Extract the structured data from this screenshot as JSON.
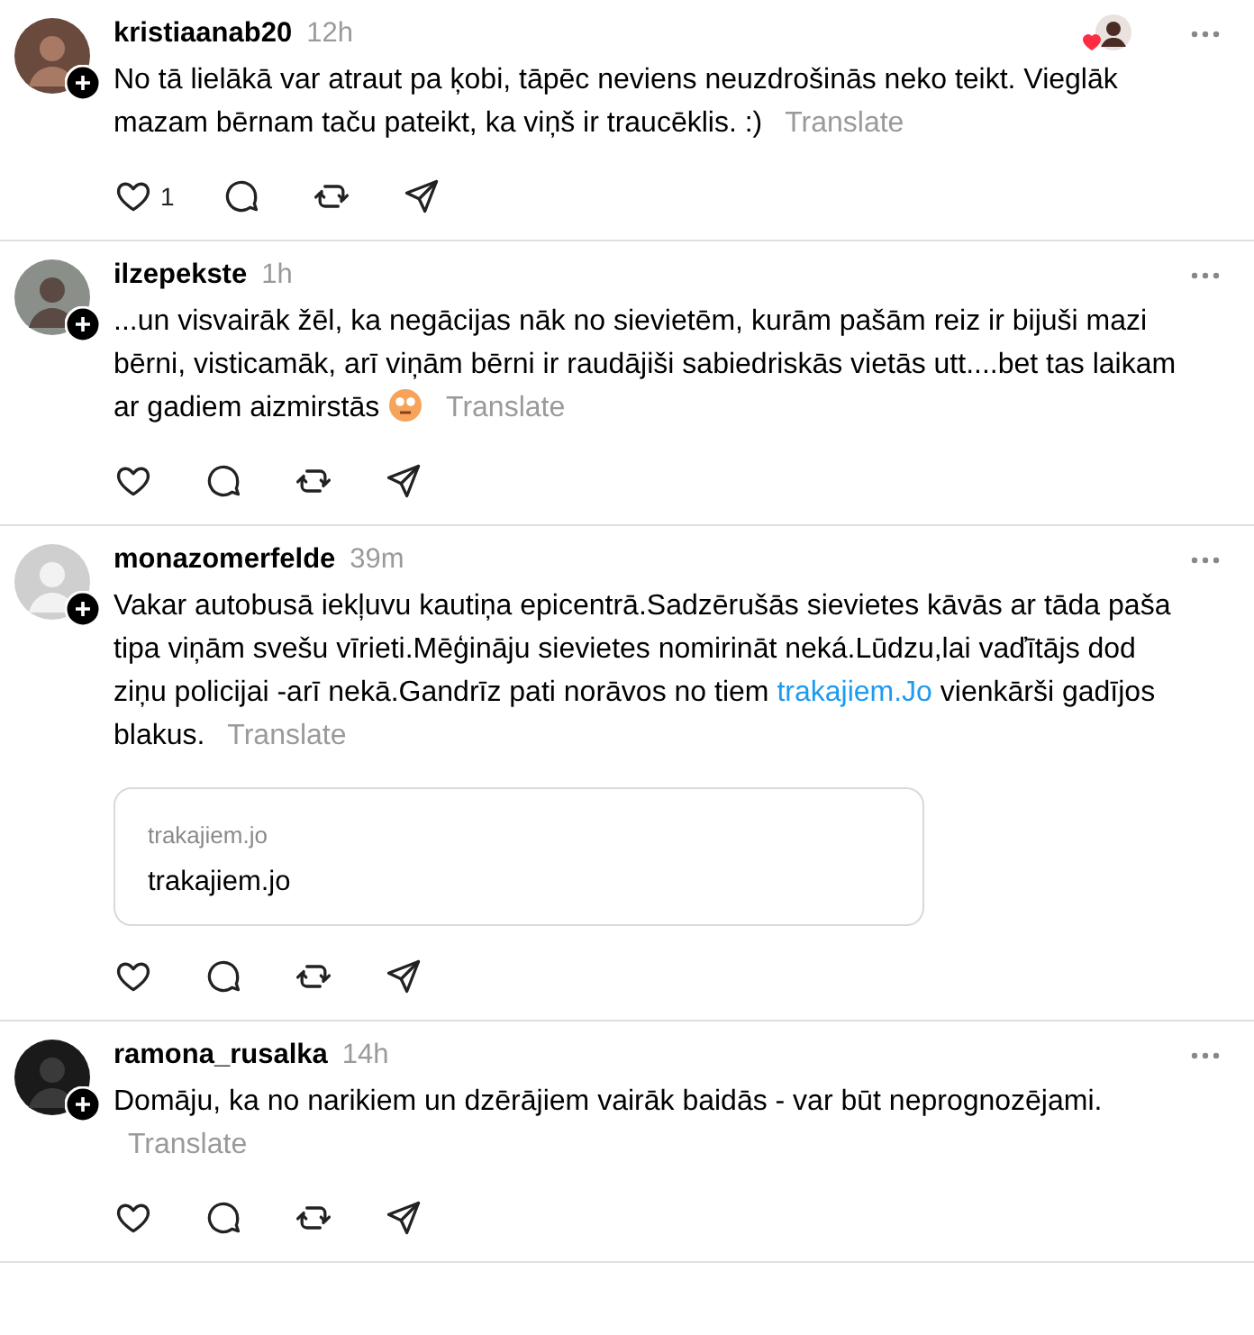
{
  "posts": [
    {
      "username": "kristiaanab20",
      "time": "12h",
      "liked_by": true,
      "parts": [
        {
          "kind": "text",
          "text": "No tā lielākā var atraut pa ķobi, tāpēc neviens neuzdrošinās neko teikt. Vieglāk mazam bērnam taču pateikt, ka viņš ir traucēklis. :)"
        }
      ],
      "translate": "Translate",
      "like_count": "1"
    },
    {
      "username": "ilzepekste",
      "time": "1h",
      "parts": [
        {
          "kind": "text",
          "text": "...un visvairāk žēl, ka negācijas nāk no sievietēm, kurām pašām reiz ir bijuši mazi bērni, visticamāk, arī viņām bērni ir raudājiši sabiedriskās vietās utt....bet tas laikam ar gadiem aizmirstās"
        },
        {
          "kind": "emoji"
        }
      ],
      "translate": "Translate"
    },
    {
      "username": "monazomerfelde",
      "time": "39m",
      "parts": [
        {
          "kind": "text",
          "text": "Vakar autobusā iekļuvu kautiņa epicentrā.Sadzērušās sievietes kāvās ar tāda paša tipa viņām svešu vīrieti.Mēģināju sievietes nomirināt neká.Lūdzu,lai vaďītājs dod ziņu policijai -arī nekā.Gandrīz pati norāvos no tiem"
        },
        {
          "kind": "link",
          "text": "trakajiem.Jo"
        },
        {
          "kind": "text",
          "text": "vienkārši gadījos blakus."
        }
      ],
      "translate": "Translate",
      "link_card": {
        "domain": "trakajiem.jo",
        "title": "trakajiem.jo"
      }
    },
    {
      "username": "ramona_rusalka",
      "time": "14h",
      "parts": [
        {
          "kind": "text",
          "text": "Domāju, ka no narikiem un dzērājiem vairāk baidās - var būt neprognozējami."
        }
      ],
      "translate": "Translate"
    }
  ]
}
